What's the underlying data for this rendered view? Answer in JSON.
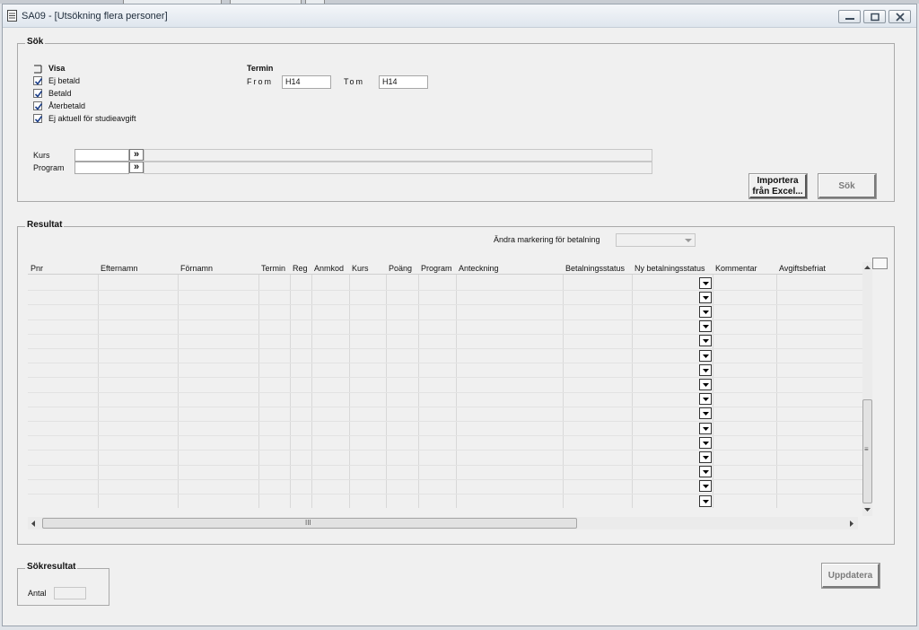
{
  "window": {
    "title": "SA09 - [Utsökning flera personer]"
  },
  "search": {
    "legend": "Sök",
    "visa_label": "Visa",
    "checkboxes": [
      {
        "label": "Ej betald",
        "checked": true
      },
      {
        "label": "Betald",
        "checked": true
      },
      {
        "label": "Återbetald",
        "checked": true
      },
      {
        "label": "Ej aktuell för studieavgift",
        "checked": true
      }
    ],
    "termin_label": "Termin",
    "from_label": "From",
    "from_value": "H14",
    "tom_label": "Tom",
    "tom_value": "H14",
    "kurs_label": "Kurs",
    "program_label": "Program",
    "picker_glyph": "»",
    "import_button": [
      "Importera",
      "från Excel..."
    ],
    "search_button": "Sök"
  },
  "results": {
    "legend": "Resultat",
    "change_marking_label": "Ändra markering för betalning",
    "columns": [
      "Pnr",
      "Efternamn",
      "Förnamn",
      "Termin",
      "Reg",
      "Anmkod",
      "Kurs",
      "Poäng",
      "Program",
      "Anteckning",
      "Betalningsstatus",
      "Ny betalningsstatus",
      "Kommentar",
      "Avgiftsbefriat"
    ],
    "hscroll_grip": "III",
    "vscroll_grip": "≡"
  },
  "summary": {
    "legend": "Sökresultat",
    "antal_label": "Antal",
    "antal_value": ""
  },
  "update_button": "Uppdatera",
  "colors": {
    "window_bg": "#f0f0f0",
    "checkbox_mark": "#1c3f8a"
  }
}
